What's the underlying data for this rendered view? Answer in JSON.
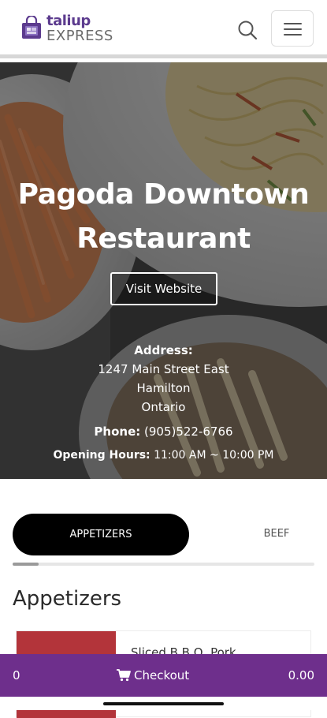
{
  "brand": {
    "name_top": "taliup",
    "name_bottom": "EXPRESS",
    "color": "#5c3b8e"
  },
  "header": {
    "search_icon": "search-icon",
    "menu_icon": "hamburger-menu-icon"
  },
  "restaurant": {
    "name": "Pagoda Downtown Restaurant",
    "visit_label": "Visit Website",
    "address_label": "Address:",
    "address_lines": [
      "1247 Main Street East",
      "Hamilton",
      "Ontario"
    ],
    "phone_label": "Phone:",
    "phone": "(905)522-6766",
    "hours_label": "Opening Hours:",
    "hours": "11:00 AM ~ 10:00 PM"
  },
  "tabs": [
    {
      "label": "APPETIZERS",
      "active": true
    },
    {
      "label": "BEEF",
      "active": false
    }
  ],
  "section": {
    "title": "Appetizers"
  },
  "items": [
    {
      "name": "Sliced B.B.Q. Pork"
    }
  ],
  "checkout": {
    "count": "0",
    "label": "Checkout",
    "total": "0.00",
    "icon": "cart-icon",
    "color": "#6e2f8c"
  }
}
